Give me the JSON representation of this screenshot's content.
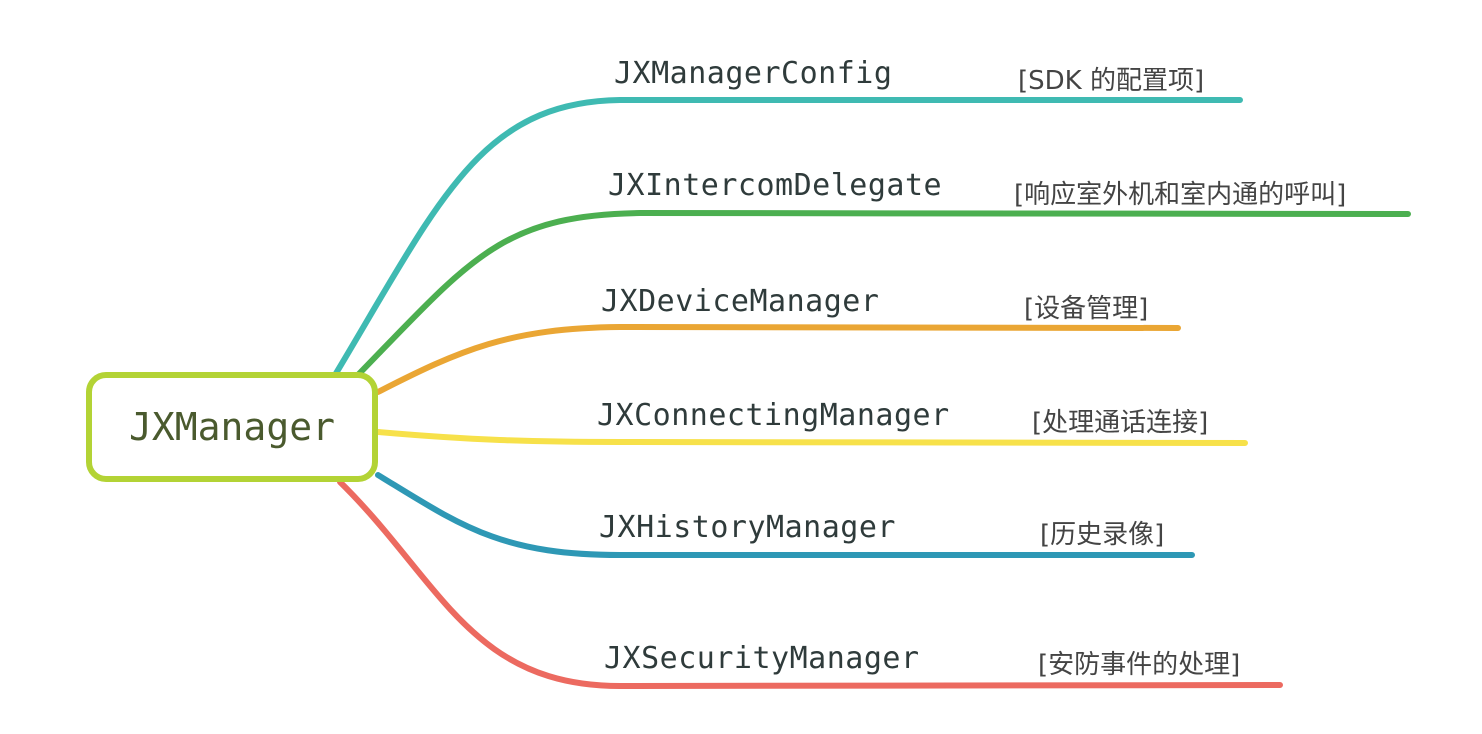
{
  "root": {
    "label": "JXManager",
    "color": "#b3d335"
  },
  "branches": [
    {
      "label": "JXManagerConfig",
      "desc": "[SDK 的配置项]",
      "color": "#3fbab2"
    },
    {
      "label": "JXIntercomDelegate",
      "desc": "[响应室外机和室内通的呼叫]",
      "color": "#4caf50"
    },
    {
      "label": "JXDeviceManager",
      "desc": "[设备管理]",
      "color": "#eaa634"
    },
    {
      "label": "JXConnectingManager",
      "desc": "[处理通话连接]",
      "color": "#f7e14a"
    },
    {
      "label": "JXHistoryManager",
      "desc": "[历史录像]",
      "color": "#2e98b5"
    },
    {
      "label": "JXSecurityManager",
      "desc": "[安防事件的处理]",
      "color": "#ec6a60"
    }
  ]
}
